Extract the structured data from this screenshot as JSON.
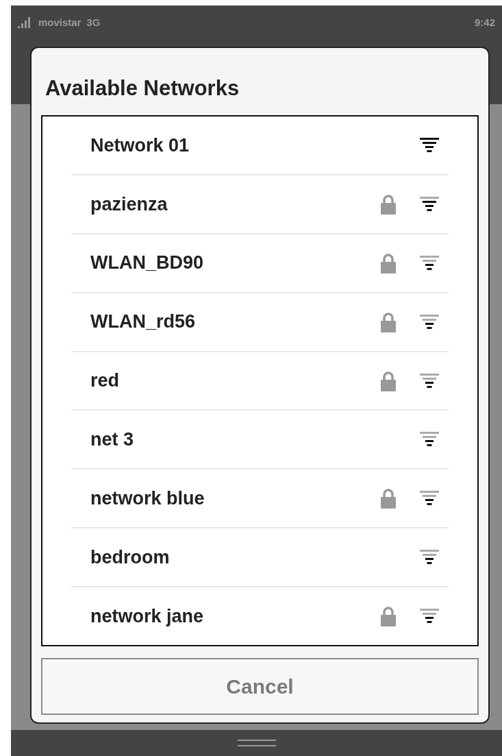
{
  "status_bar": {
    "carrier": "movistar",
    "network": "3G",
    "time": "9:42"
  },
  "dialog": {
    "title": "Available Networks",
    "networks": [
      {
        "name": "Network 01",
        "locked": false,
        "signal": {
          "level": 1
        }
      },
      {
        "name": "pazienza",
        "locked": true,
        "signal": {
          "level": 0.75
        }
      },
      {
        "name": "WLAN_BD90",
        "locked": true,
        "signal": {
          "level": 0.5
        }
      },
      {
        "name": "WLAN_rd56",
        "locked": true,
        "signal": {
          "level": 0.5
        }
      },
      {
        "name": "red",
        "locked": true,
        "signal": {
          "level": 0.5
        }
      },
      {
        "name": "net 3",
        "locked": false,
        "signal": {
          "level": 0.5
        }
      },
      {
        "name": "network blue",
        "locked": true,
        "signal": {
          "level": 0.5
        }
      },
      {
        "name": "bedroom",
        "locked": false,
        "signal": {
          "level": 0.5
        }
      },
      {
        "name": "network jane",
        "locked": true,
        "signal": {
          "level": 0.5
        }
      }
    ],
    "cancel_button": "Cancel"
  }
}
